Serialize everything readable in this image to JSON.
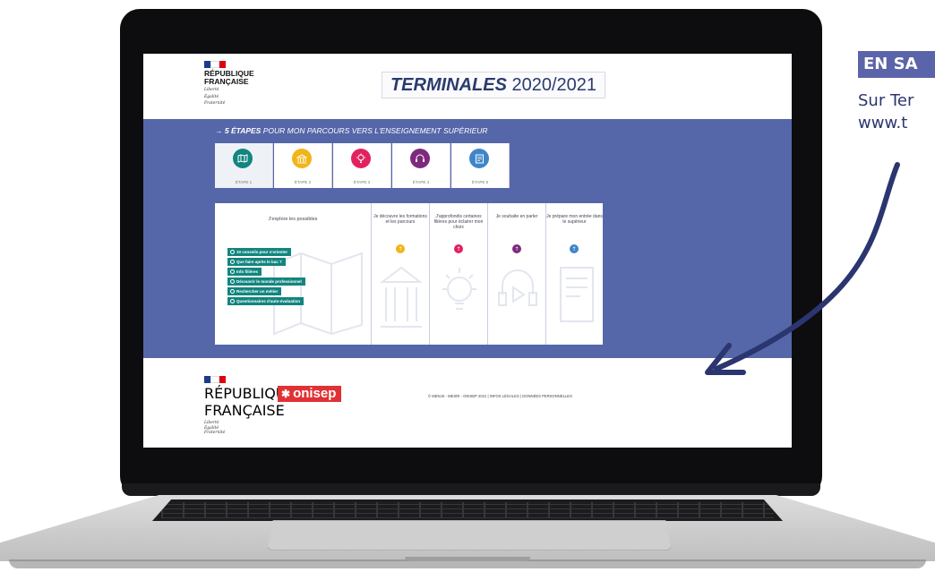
{
  "page": {
    "logo_text": [
      "RÉPUBLIQUE",
      "FRANÇAISE"
    ],
    "motto": [
      "Liberté",
      "Égalité",
      "Fraternité"
    ],
    "title_bold": "TERMINALES",
    "title_year": "2020/2021",
    "banner_arrow": "→",
    "banner_bold": "5 ÉTAPES",
    "banner_rest": " POUR MON PARCOURS VERS L'ENSEIGNEMENT SUPÉRIEUR"
  },
  "steps": [
    {
      "label": "ÉTAPE 1",
      "color": "#12857e",
      "icon": "map-icon"
    },
    {
      "label": "ÉTAPE 2",
      "color": "#f2b417",
      "icon": "building-icon"
    },
    {
      "label": "ÉTAPE 3",
      "color": "#e2215f",
      "icon": "lightbulb-icon"
    },
    {
      "label": "ÉTAPE 4",
      "color": "#7d2a7e",
      "icon": "headset-icon"
    },
    {
      "label": "ÉTAPE 5",
      "color": "#3f86c8",
      "icon": "form-icon"
    }
  ],
  "columns": [
    {
      "head": "J'explore les possibles"
    },
    {
      "head": "Je découvre les formations et les parcours",
      "dot_color": "#f2b417"
    },
    {
      "head": "J'approfondis certaines filières pour éclairer mon choix",
      "dot_color": "#e2215f"
    },
    {
      "head": "Je souhaite en parler",
      "dot_color": "#7d2a7e"
    },
    {
      "head": "Je prépare mon entrée dans le supérieur",
      "dot_color": "#3f86c8"
    }
  ],
  "links": [
    "10 conseils pour s'orienter",
    "Que faire après le bac ?",
    "Info filières",
    "Découvrir le monde professionnel",
    "Rechercher un métier",
    "Questionnaires d'auto-évaluation"
  ],
  "footer": {
    "brand": "onisep",
    "legal": "© MENJS - MESRI - ONISEP 2021  |  INFOS LÉGALES  |  DONNÉES PERSONNELLES"
  },
  "callout": {
    "tag": "EN SA",
    "line1": "Sur Ter",
    "line2": "www.t"
  },
  "colors": {
    "band": "#5566a9",
    "title": "#2a3b6e",
    "callout": "#2b3570"
  }
}
